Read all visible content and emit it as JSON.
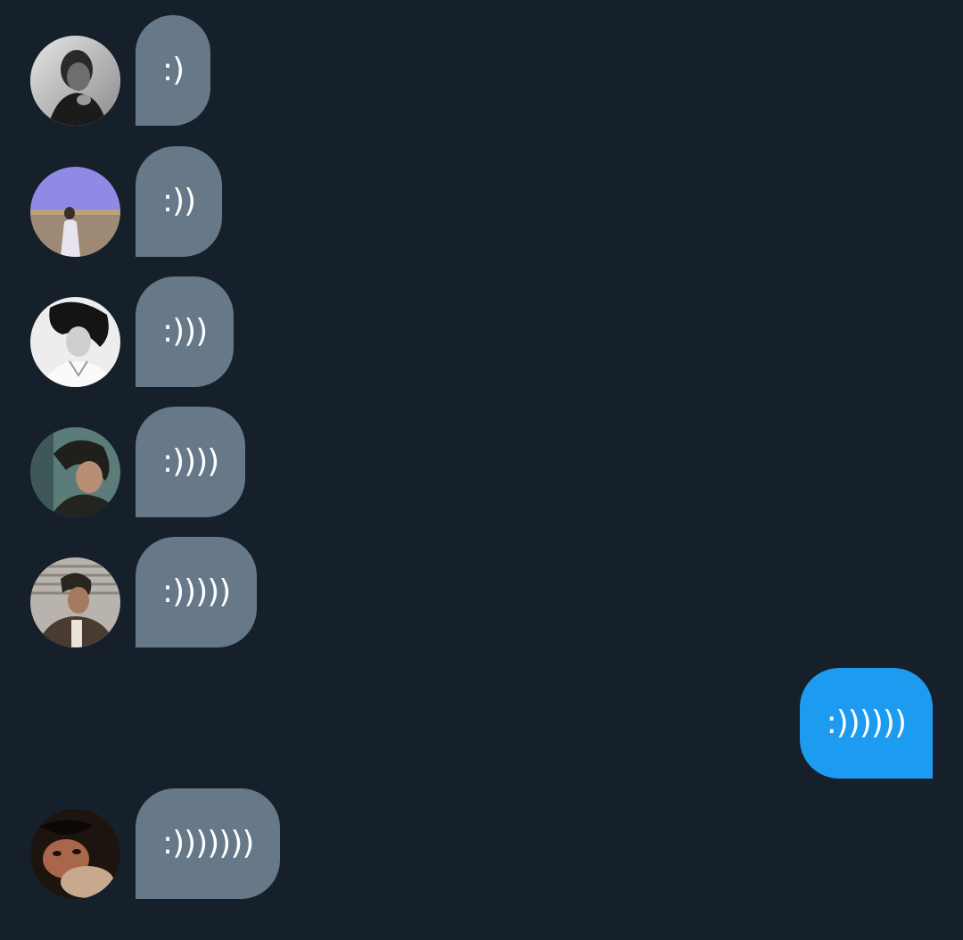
{
  "conversation": {
    "messages": [
      {
        "direction": "incoming",
        "text": ":)",
        "avatar": "avatar-bw-portrait"
      },
      {
        "direction": "incoming",
        "text": ":))",
        "avatar": "avatar-field-purple-sky"
      },
      {
        "direction": "incoming",
        "text": ":)))",
        "avatar": "avatar-bw-profile"
      },
      {
        "direction": "incoming",
        "text": ":))))",
        "avatar": "avatar-teal-profile"
      },
      {
        "direction": "incoming",
        "text": ":)))))",
        "avatar": "avatar-window-portrait"
      },
      {
        "direction": "outgoing",
        "text": ":))))))"
      },
      {
        "direction": "incoming",
        "text": ":)))))))",
        "avatar": "avatar-dark-closeup"
      }
    ]
  },
  "colors": {
    "background": "#16202b",
    "incoming_bubble": "#677888",
    "outgoing_bubble": "#1d9bf0",
    "text": "#ffffff"
  }
}
